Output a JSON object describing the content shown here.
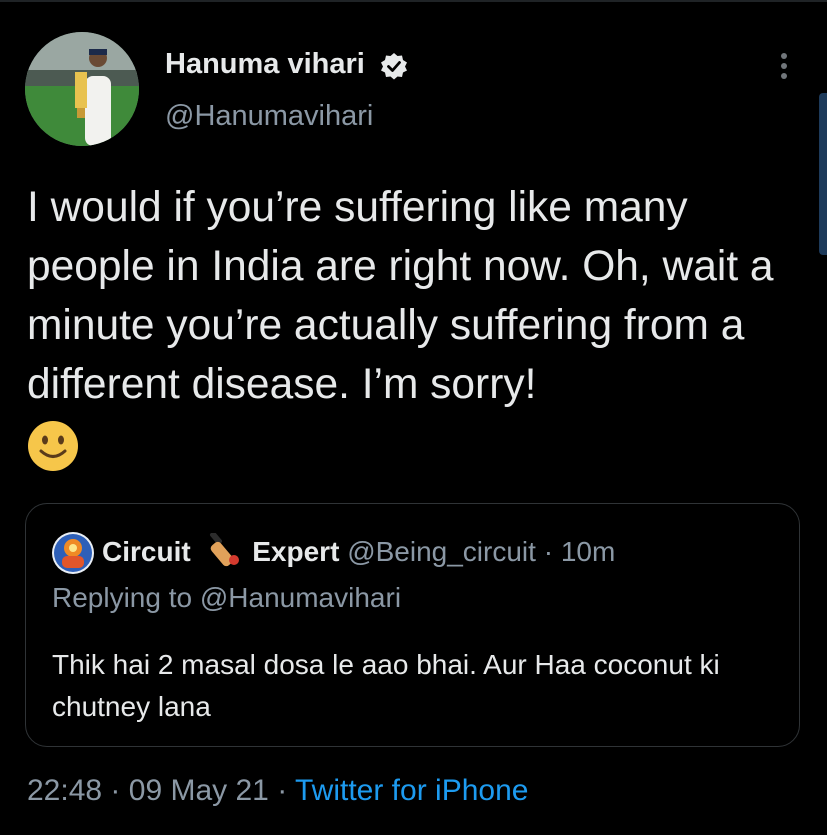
{
  "author": {
    "name": "Hanuma vihari",
    "handle": "@Hanumavihari"
  },
  "tweet": {
    "text": "I would if you’re suffering like many people in India are right now. Oh, wait a minute you’re actually suffering from a different disease. I’m sorry!",
    "emoji": "slightly-smiling-face"
  },
  "quoted": {
    "name_part1": "Circuit",
    "name_emoji": "cricket-bat-icon",
    "name_part2": "Expert",
    "handle": "@Being_circuit",
    "separator": "·",
    "time": "10m",
    "replying_prefix": "Replying to",
    "replying_handle": "@Hanumavihari",
    "text": "Thik hai 2 masal dosa le aao bhai. Aur Haa coconut ki chutney lana"
  },
  "meta": {
    "time": "22:48",
    "dot1": "·",
    "date": "09 May 21",
    "dot2": "·",
    "source": "Twitter for iPhone"
  },
  "colors": {
    "background": "#000000",
    "text": "#e7e9ea",
    "muted": "#8b98a5",
    "accent": "#1d9bf0",
    "border": "#2f3336"
  }
}
